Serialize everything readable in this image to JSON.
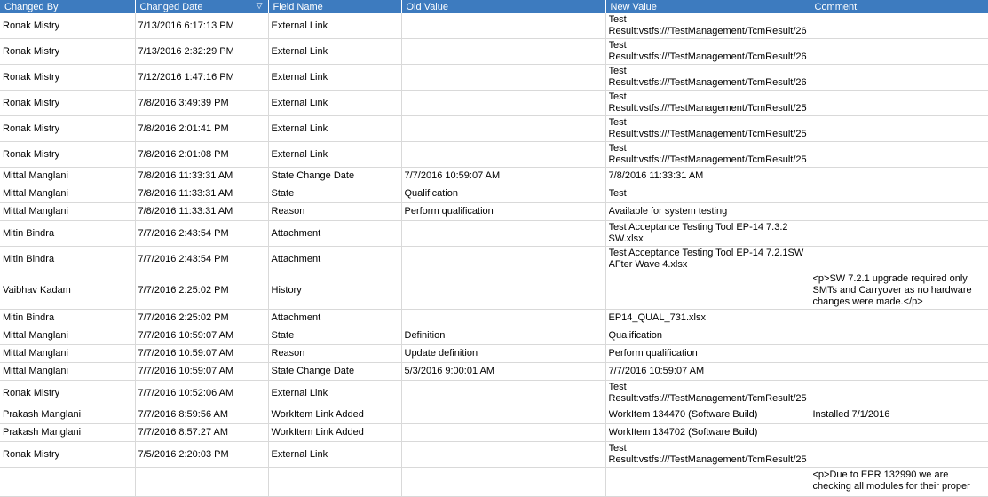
{
  "columns": [
    "Changed By",
    "Changed Date",
    "Field Name",
    "Old Value",
    "New Value",
    "Comment"
  ],
  "rows": [
    {
      "by": "Ronak Mistry",
      "date": "7/13/2016 6:17:13 PM",
      "field": "External Link",
      "old": "",
      "new1": "Test",
      "new2": "Result:vstfs:///TestManagement/TcmResult/26",
      "comment": "",
      "h": "n"
    },
    {
      "by": "Ronak Mistry",
      "date": "7/13/2016 2:32:29 PM",
      "field": "External Link",
      "old": "",
      "new1": "Test",
      "new2": "Result:vstfs:///TestManagement/TcmResult/26",
      "comment": "",
      "h": "n"
    },
    {
      "by": "Ronak Mistry",
      "date": "7/12/2016 1:47:16 PM",
      "field": "External Link",
      "old": "",
      "new1": "Test",
      "new2": "Result:vstfs:///TestManagement/TcmResult/26",
      "comment": "",
      "h": "n"
    },
    {
      "by": "Ronak Mistry",
      "date": "7/8/2016 3:49:39 PM",
      "field": "External Link",
      "old": "",
      "new1": "Test",
      "new2": "Result:vstfs:///TestManagement/TcmResult/25",
      "comment": "",
      "h": "n"
    },
    {
      "by": "Ronak Mistry",
      "date": "7/8/2016 2:01:41 PM",
      "field": "External Link",
      "old": "",
      "new1": "Test",
      "new2": "Result:vstfs:///TestManagement/TcmResult/25",
      "comment": "",
      "h": "n"
    },
    {
      "by": "Ronak Mistry",
      "date": "7/8/2016 2:01:08 PM",
      "field": "External Link",
      "old": "",
      "new1": "Test",
      "new2": "Result:vstfs:///TestManagement/TcmResult/25",
      "comment": "",
      "h": "n"
    },
    {
      "by": "Mittal Manglani",
      "date": "7/8/2016 11:33:31 AM",
      "field": "State Change Date",
      "old": "7/7/2016 10:59:07 AM",
      "new1": "7/8/2016 11:33:31 AM",
      "new2": "",
      "comment": "",
      "h": "s"
    },
    {
      "by": "Mittal Manglani",
      "date": "7/8/2016 11:33:31 AM",
      "field": "State",
      "old": "Qualification",
      "new1": "Test",
      "new2": "",
      "comment": "",
      "h": "s"
    },
    {
      "by": "Mittal Manglani",
      "date": "7/8/2016 11:33:31 AM",
      "field": "Reason",
      "old": "Perform qualification",
      "new1": "Available for system testing",
      "new2": "",
      "comment": "",
      "h": "s"
    },
    {
      "by": "Mitin Bindra",
      "date": "7/7/2016 2:43:54 PM",
      "field": "Attachment",
      "old": "",
      "new1": "Test Acceptance Testing Tool EP-14 7.3.2",
      "new2": "SW.xlsx",
      "comment": "",
      "h": "n"
    },
    {
      "by": "Mitin Bindra",
      "date": "7/7/2016 2:43:54 PM",
      "field": "Attachment",
      "old": "",
      "new1": "Test Acceptance Testing Tool EP-14 7.2.1SW",
      "new2": "AFter Wave 4.xlsx",
      "comment": "",
      "h": "n"
    },
    {
      "by": "Vaibhav Kadam",
      "date": "7/7/2016 2:25:02 PM",
      "field": "History",
      "old": "",
      "new1": "",
      "new2": "",
      "comment": "<p>SW 7.2.1 upgrade required only SMTs and Carryover as no hardware changes were made.</p>",
      "h": "t"
    },
    {
      "by": "Mitin Bindra",
      "date": "7/7/2016 2:25:02 PM",
      "field": "Attachment",
      "old": "",
      "new1": "EP14_QUAL_731.xlsx",
      "new2": "",
      "comment": "",
      "h": "s"
    },
    {
      "by": "Mittal Manglani",
      "date": "7/7/2016 10:59:07 AM",
      "field": "State",
      "old": "Definition",
      "new1": "Qualification",
      "new2": "",
      "comment": "",
      "h": "s"
    },
    {
      "by": "Mittal Manglani",
      "date": "7/7/2016 10:59:07 AM",
      "field": "Reason",
      "old": "Update definition",
      "new1": "Perform qualification",
      "new2": "",
      "comment": "",
      "h": "s"
    },
    {
      "by": "Mittal Manglani",
      "date": "7/7/2016 10:59:07 AM",
      "field": "State Change Date",
      "old": "5/3/2016 9:00:01 AM",
      "new1": "7/7/2016 10:59:07 AM",
      "new2": "",
      "comment": "",
      "h": "s"
    },
    {
      "by": "Ronak Mistry",
      "date": "7/7/2016 10:52:06 AM",
      "field": "External Link",
      "old": "",
      "new1": "Test",
      "new2": "Result:vstfs:///TestManagement/TcmResult/25",
      "comment": "",
      "h": "n"
    },
    {
      "by": "Prakash Manglani",
      "date": "7/7/2016 8:59:56 AM",
      "field": "WorkItem Link Added",
      "old": "",
      "new1": "WorkItem 134470 (Software Build)",
      "new2": "",
      "comment": "Installed 7/1/2016",
      "h": "s"
    },
    {
      "by": "Prakash Manglani",
      "date": "7/7/2016 8:57:27 AM",
      "field": "WorkItem Link Added",
      "old": "",
      "new1": "WorkItem 134702 (Software Build)",
      "new2": "",
      "comment": "",
      "h": "s"
    },
    {
      "by": "Ronak Mistry",
      "date": "7/5/2016 2:20:03 PM",
      "field": "External Link",
      "old": "",
      "new1": "Test",
      "new2": "Result:vstfs:///TestManagement/TcmResult/25",
      "comment": "",
      "h": "n"
    },
    {
      "by": "",
      "date": "",
      "field": "",
      "old": "",
      "new1": "",
      "new2": "",
      "comment": "<p>Due to EPR 132990 we are checking all modules for their proper",
      "h": "c"
    }
  ]
}
